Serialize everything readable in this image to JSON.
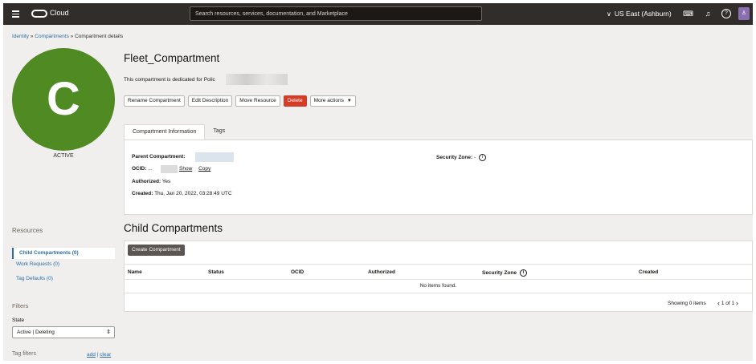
{
  "topbar": {
    "brand": "Cloud",
    "search_placeholder": "Search resources, services, documentation, and Marketplace",
    "region": "US East (Ashburn)",
    "icons": [
      "menu-icon",
      "cloud-shell-icon",
      "bell-icon",
      "help-icon",
      "user-icon"
    ]
  },
  "breadcrumb": {
    "identity": "Identity",
    "compartments": "Compartments",
    "current": "Compartment details",
    "separator": "»"
  },
  "compartment": {
    "avatar_letter": "C",
    "avatar_color": "#4f8a23",
    "status": "ACTIVE",
    "name": "Fleet_Compartment",
    "description": "This compartment is dedicated for Polic"
  },
  "actions": {
    "rename": "Rename Compartment",
    "edit_description": "Edit Description",
    "move": "Move Resource",
    "delete": "Delete",
    "more": "More actions"
  },
  "tabs": {
    "info": "Compartment Information",
    "tags": "Tags"
  },
  "info": {
    "parent_label": "Parent Compartment:",
    "ocid_label": "OCID:",
    "ocid_value": "...",
    "show": "Show",
    "copy": "Copy",
    "authorized_label": "Authorized:",
    "authorized_value": "Yes",
    "created_label": "Created:",
    "created_value": "Thu, Jan 20, 2022, 03:28:49 UTC",
    "security_zone_label": "Security Zone:",
    "security_zone_value": "-"
  },
  "resources": {
    "heading": "Resources",
    "items": [
      {
        "label": "Child Compartments (0)"
      },
      {
        "label": "Work Requests (0)"
      },
      {
        "label": "Tag Defaults (0)"
      }
    ]
  },
  "filters": {
    "heading": "Filters",
    "state_label": "State",
    "state_value": "Active | Deleting",
    "tag_filters": "Tag filters",
    "add": "add",
    "clear": "clear"
  },
  "child": {
    "title": "Child Compartments",
    "create_button": "Create Compartment",
    "columns": [
      "Name",
      "Status",
      "OCID",
      "Authorized",
      "Security Zone",
      "Created"
    ],
    "empty_text": "No items found.",
    "showing": "Showing 0 items",
    "page": "1 of 1"
  },
  "colors": {
    "topbar": "#312d2a",
    "link": "#2b6ea6",
    "danger": "#d63b25"
  }
}
